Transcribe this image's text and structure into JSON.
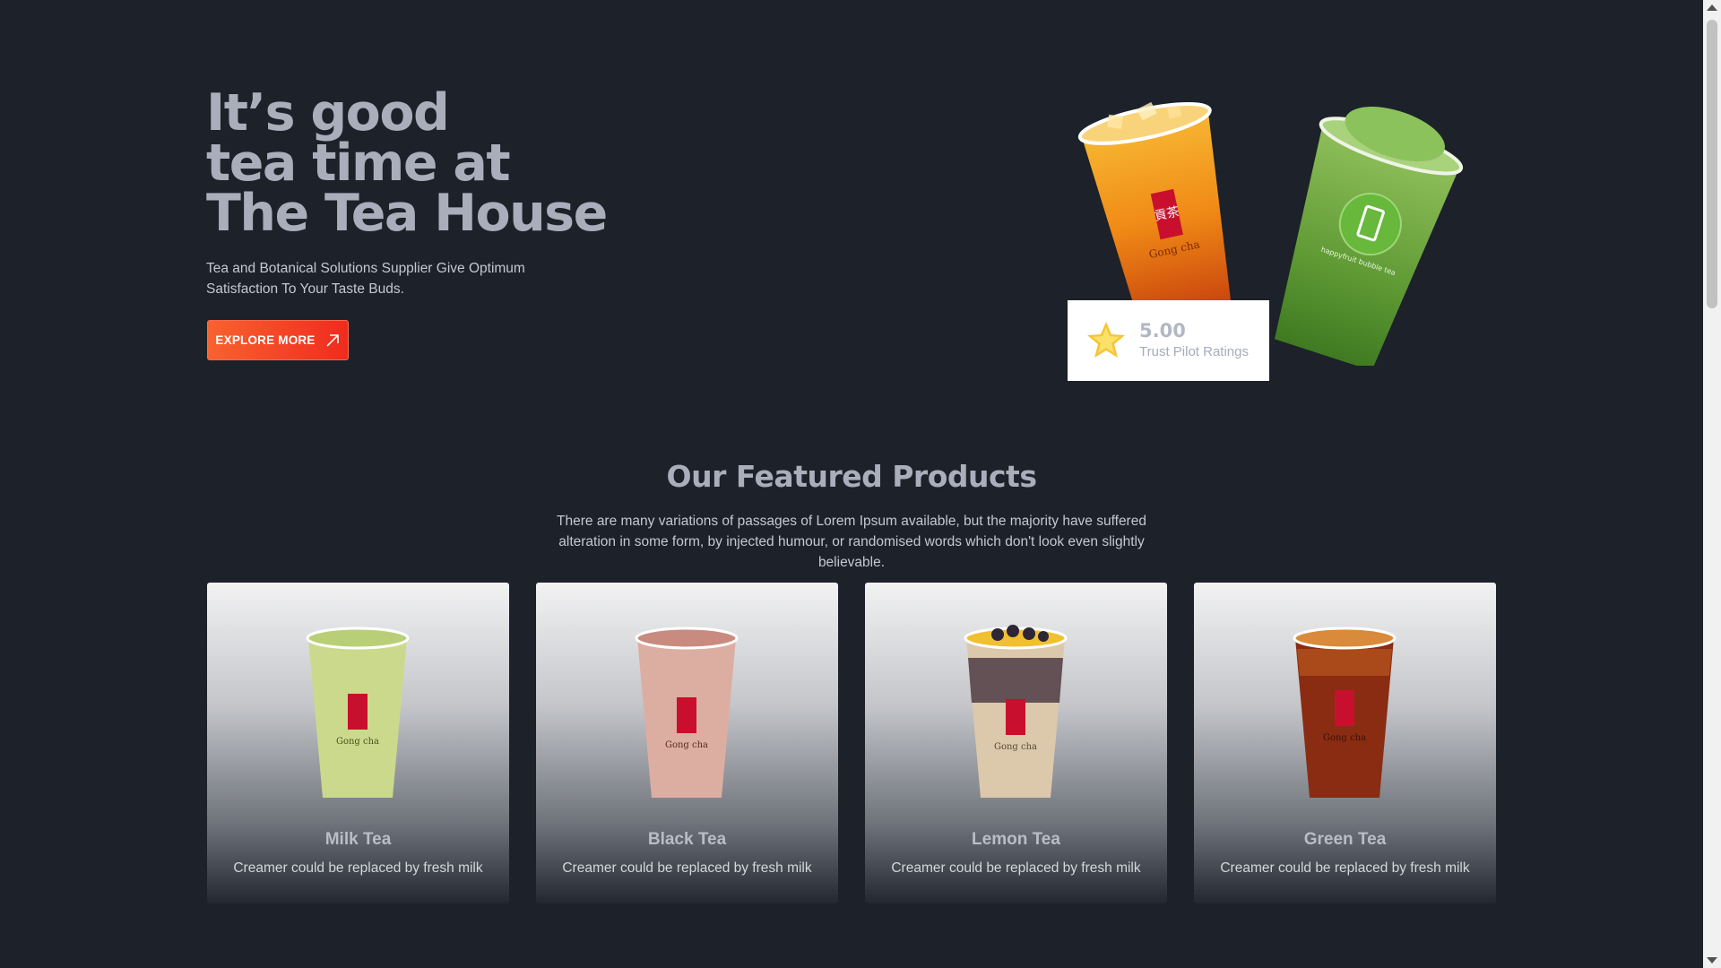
{
  "hero": {
    "title_lines": [
      "It’s good",
      "tea time at",
      "The Tea House"
    ],
    "subtitle": "Tea and Botanical Solutions Supplier Give Optimum Satisfaction To Your Taste Buds.",
    "button_label": "EXPLORE MORE",
    "button_icon": "arrow-up-right-icon",
    "rating": {
      "value": "5.00",
      "label": "Trust Pilot Ratings",
      "icon": "star-icon"
    },
    "cup_labels": {
      "orange_brand": "Gong cha",
      "orange_logo_chars": "貢茶",
      "green_badge": "happyfruit bubble tea"
    }
  },
  "featured": {
    "title": "Our Featured Products",
    "description": "There are many variations of passages of Lorem Ipsum available, but the majority have suffered alteration in some form, by injected humour, or randomised words which don't look even slightly believable.",
    "products": [
      {
        "name": "Milk Tea",
        "desc": "Creamer could be replaced by fresh milk",
        "brand": "Gong cha",
        "drink_color": "#c9d888"
      },
      {
        "name": "Black Tea",
        "desc": "Creamer could be replaced by fresh milk",
        "brand": "Gong cha",
        "drink_color": "#d9a59a"
      },
      {
        "name": "Lemon Tea",
        "desc": "Creamer could be replaced by fresh milk",
        "brand": "Gong cha",
        "drink_color": "#d9c3a6"
      },
      {
        "name": "Green Tea",
        "desc": "Creamer could be replaced by fresh milk",
        "brand": "Gong cha",
        "drink_color": "#8a2a12"
      }
    ]
  },
  "colors": {
    "background": "#1d2129",
    "accent_start": "#f8622f",
    "accent_end": "#f02b1e",
    "title_text": "#a9aebb",
    "logo_red": "#c8102e"
  }
}
